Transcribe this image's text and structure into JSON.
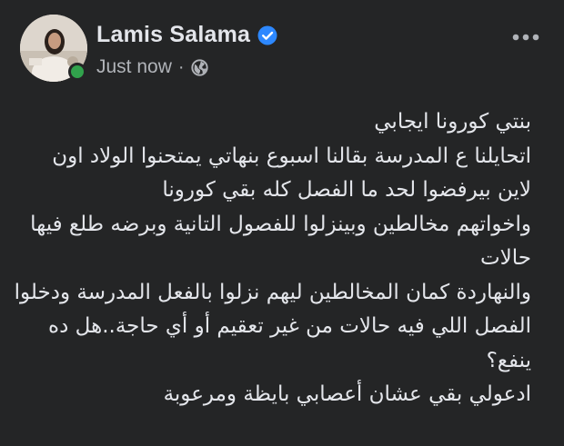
{
  "post": {
    "author": {
      "name": "Lamis Salama",
      "verified": true,
      "online": true,
      "avatar_icon": "profile-photo"
    },
    "timestamp": "Just now",
    "separator": "·",
    "audience_icon": "globe-icon",
    "more_icon": "more-horizontal-icon",
    "body_lines": [
      "بنتي كورونا ايجابي",
      "اتحايلنا ع المدرسة بقالنا اسبوع بنهاتي يمتحنوا الولاد اون",
      "لاين بيرفضوا لحد ما الفصل كله بقي كورونا",
      "واخواتهم مخالطين وبينزلوا للفصول التانية وبرضه طلع فيها",
      "حالات",
      "والنهاردة كمان المخالطين ليهم نزلوا بالفعل المدرسة ودخلوا",
      "الفصل اللي فيه حالات من غير تعقيم أو أي حاجة..هل ده",
      "ينفع؟",
      "ادعولي بقي عشان أعصابي بايظة ومرعوبة"
    ]
  },
  "colors": {
    "background": "#242526",
    "primary_text": "#e4e6eb",
    "secondary_text": "#b0b3b8",
    "verified_badge": "#2d88ff",
    "online": "#31a24c"
  }
}
